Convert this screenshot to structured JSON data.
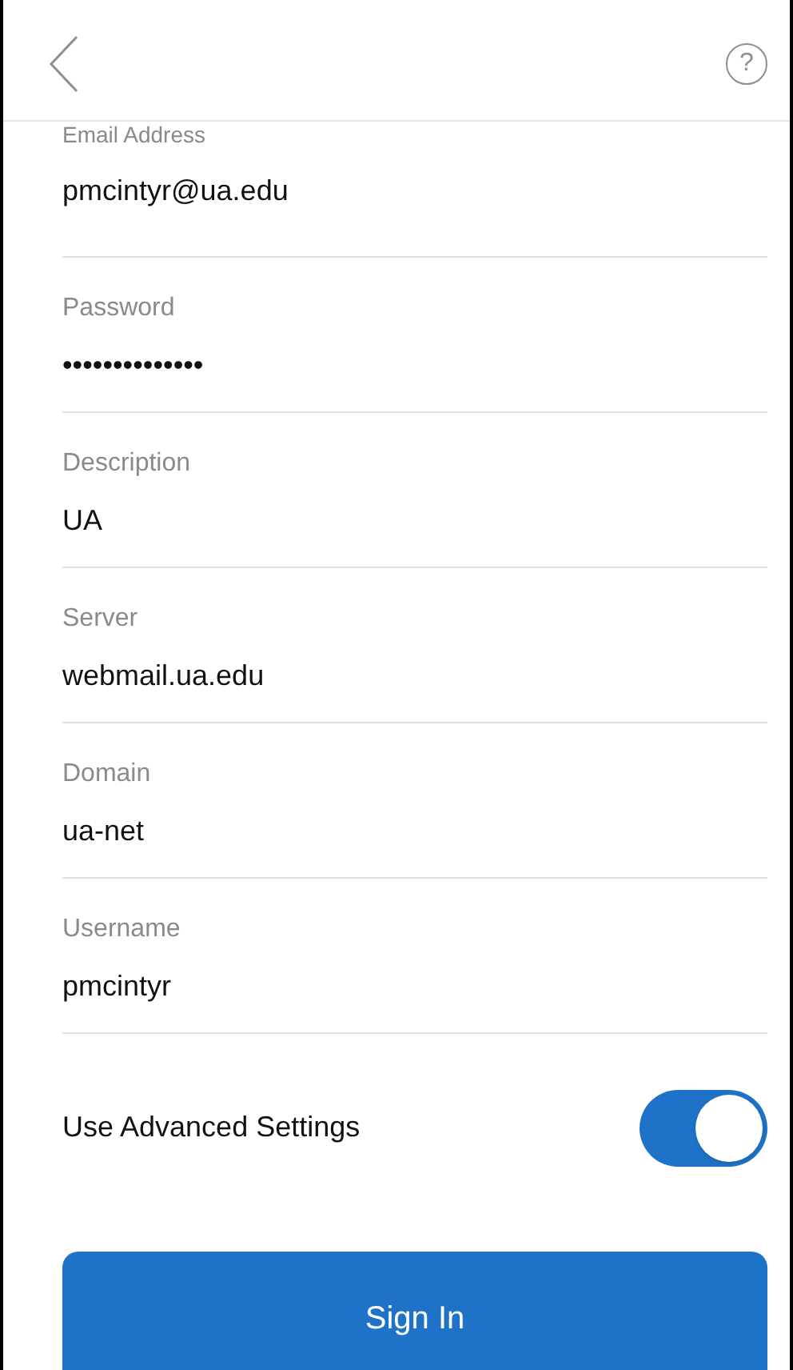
{
  "header": {
    "help": "?"
  },
  "fields": [
    {
      "label": "Email Address",
      "value": "pmcintyr@ua.edu"
    },
    {
      "label": "Password",
      "value": "••••••••••••••"
    },
    {
      "label": "Description",
      "value": "UA"
    },
    {
      "label": "Server",
      "value": "webmail.ua.edu"
    },
    {
      "label": "Domain",
      "value": "ua-net"
    },
    {
      "label": "Username",
      "value": "pmcintyr"
    }
  ],
  "advanced": {
    "label": "Use Advanced Settings",
    "on": true
  },
  "sign_in": "Sign In"
}
